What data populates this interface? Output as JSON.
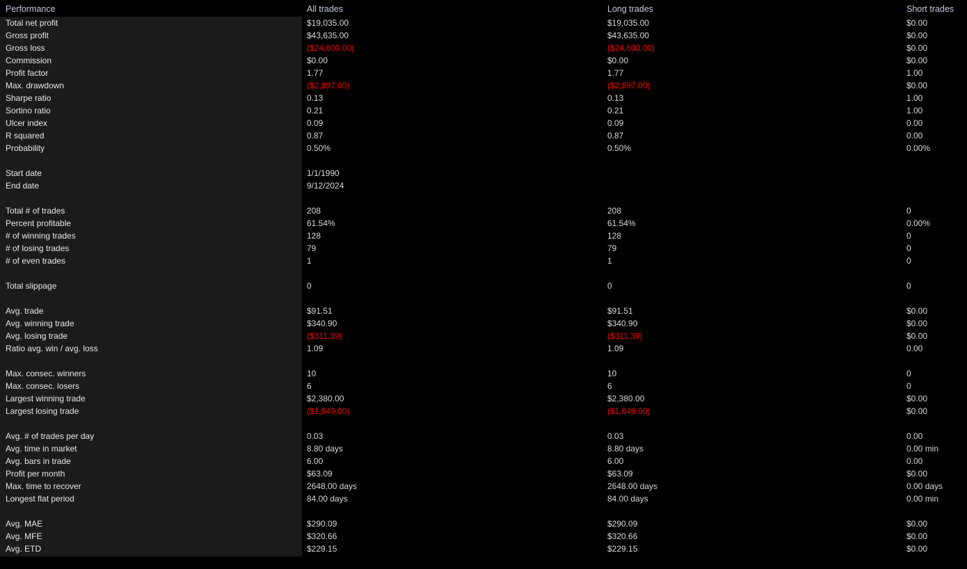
{
  "header": {
    "performance_label": "Performance",
    "all_trades_label": "All trades",
    "long_trades_label": "Long trades",
    "short_trades_label": "Short trades"
  },
  "colors": {
    "background": "#000000",
    "label_panel": "#1b1b1b",
    "header_text": "#c3ccda",
    "body_text": "#e8e8e8",
    "negative": "#ff0000"
  },
  "rows": [
    {
      "label": "Total net profit",
      "all": "$19,035.00",
      "long": "$19,035.00",
      "short": "$0.00",
      "all_neg": false,
      "long_neg": false,
      "short_neg": false
    },
    {
      "label": "Gross profit",
      "all": "$43,635.00",
      "long": "$43,635.00",
      "short": "$0.00",
      "all_neg": false,
      "long_neg": false,
      "short_neg": false
    },
    {
      "label": "Gross loss",
      "all": "($24,600.00)",
      "long": "($24,600.00)",
      "short": "$0.00",
      "all_neg": true,
      "long_neg": true,
      "short_neg": false
    },
    {
      "label": "Commission",
      "all": "$0.00",
      "long": "$0.00",
      "short": "$0.00",
      "all_neg": false,
      "long_neg": false,
      "short_neg": false
    },
    {
      "label": "Profit factor",
      "all": "1.77",
      "long": "1.77",
      "short": "1.00",
      "all_neg": false,
      "long_neg": false,
      "short_neg": false
    },
    {
      "label": "Max. drawdown",
      "all": "($2,897.00)",
      "long": "($2,897.00)",
      "short": "$0.00",
      "all_neg": true,
      "long_neg": true,
      "short_neg": false
    },
    {
      "label": "Sharpe ratio",
      "all": "0.13",
      "long": "0.13",
      "short": "1.00",
      "all_neg": false,
      "long_neg": false,
      "short_neg": false
    },
    {
      "label": "Sortino ratio",
      "all": "0.21",
      "long": "0.21",
      "short": "1.00",
      "all_neg": false,
      "long_neg": false,
      "short_neg": false
    },
    {
      "label": "Ulcer index",
      "all": "0.09",
      "long": "0.09",
      "short": "0.00",
      "all_neg": false,
      "long_neg": false,
      "short_neg": false
    },
    {
      "label": "R squared",
      "all": "0.87",
      "long": "0.87",
      "short": "0.00",
      "all_neg": false,
      "long_neg": false,
      "short_neg": false
    },
    {
      "label": "Probability",
      "all": "0.50%",
      "long": "0.50%",
      "short": "0.00%",
      "all_neg": false,
      "long_neg": false,
      "short_neg": false
    },
    {
      "spacer": true
    },
    {
      "label": "Start date",
      "all": "1/1/1990",
      "long": "",
      "short": "",
      "all_neg": false,
      "long_neg": false,
      "short_neg": false
    },
    {
      "label": "End date",
      "all": "9/12/2024",
      "long": "",
      "short": "",
      "all_neg": false,
      "long_neg": false,
      "short_neg": false
    },
    {
      "spacer": true
    },
    {
      "label": "Total # of trades",
      "all": "208",
      "long": "208",
      "short": "0",
      "all_neg": false,
      "long_neg": false,
      "short_neg": false
    },
    {
      "label": "Percent profitable",
      "all": "61.54%",
      "long": "61.54%",
      "short": "0.00%",
      "all_neg": false,
      "long_neg": false,
      "short_neg": false
    },
    {
      "label": "# of winning trades",
      "all": "128",
      "long": "128",
      "short": "0",
      "all_neg": false,
      "long_neg": false,
      "short_neg": false
    },
    {
      "label": "# of losing trades",
      "all": "79",
      "long": "79",
      "short": "0",
      "all_neg": false,
      "long_neg": false,
      "short_neg": false
    },
    {
      "label": "# of even trades",
      "all": "1",
      "long": "1",
      "short": "0",
      "all_neg": false,
      "long_neg": false,
      "short_neg": false
    },
    {
      "spacer": true
    },
    {
      "label": "Total slippage",
      "all": "0",
      "long": "0",
      "short": "0",
      "all_neg": false,
      "long_neg": false,
      "short_neg": false
    },
    {
      "spacer": true
    },
    {
      "label": "Avg. trade",
      "all": "$91.51",
      "long": "$91.51",
      "short": "$0.00",
      "all_neg": false,
      "long_neg": false,
      "short_neg": false
    },
    {
      "label": "Avg. winning trade",
      "all": "$340.90",
      "long": "$340.90",
      "short": "$0.00",
      "all_neg": false,
      "long_neg": false,
      "short_neg": false
    },
    {
      "label": "Avg. losing trade",
      "all": "($311.39)",
      "long": "($311.39)",
      "short": "$0.00",
      "all_neg": true,
      "long_neg": true,
      "short_neg": false
    },
    {
      "label": "Ratio avg. win / avg. loss",
      "all": "1.09",
      "long": "1.09",
      "short": "0.00",
      "all_neg": false,
      "long_neg": false,
      "short_neg": false
    },
    {
      "spacer": true
    },
    {
      "label": "Max. consec. winners",
      "all": "10",
      "long": "10",
      "short": "0",
      "all_neg": false,
      "long_neg": false,
      "short_neg": false
    },
    {
      "label": "Max. consec. losers",
      "all": "6",
      "long": "6",
      "short": "0",
      "all_neg": false,
      "long_neg": false,
      "short_neg": false
    },
    {
      "label": "Largest winning trade",
      "all": "$2,380.00",
      "long": "$2,380.00",
      "short": "$0.00",
      "all_neg": false,
      "long_neg": false,
      "short_neg": false
    },
    {
      "label": "Largest losing trade",
      "all": "($1,649.00)",
      "long": "($1,649.00)",
      "short": "$0.00",
      "all_neg": true,
      "long_neg": true,
      "short_neg": false
    },
    {
      "spacer": true
    },
    {
      "label": "Avg. # of trades per day",
      "all": "0.03",
      "long": "0.03",
      "short": "0.00",
      "all_neg": false,
      "long_neg": false,
      "short_neg": false
    },
    {
      "label": "Avg. time in market",
      "all": "8.80 days",
      "long": "8.80 days",
      "short": "0.00 min",
      "all_neg": false,
      "long_neg": false,
      "short_neg": false
    },
    {
      "label": "Avg. bars in trade",
      "all": "6.00",
      "long": "6.00",
      "short": "0.00",
      "all_neg": false,
      "long_neg": false,
      "short_neg": false
    },
    {
      "label": "Profit per month",
      "all": "$63.09",
      "long": "$63.09",
      "short": "$0.00",
      "all_neg": false,
      "long_neg": false,
      "short_neg": false
    },
    {
      "label": "Max. time to recover",
      "all": "2648.00 days",
      "long": "2648.00 days",
      "short": "0.00 days",
      "all_neg": false,
      "long_neg": false,
      "short_neg": false
    },
    {
      "label": "Longest flat period",
      "all": "84.00 days",
      "long": "84.00 days",
      "short": "0.00 min",
      "all_neg": false,
      "long_neg": false,
      "short_neg": false
    },
    {
      "spacer": true
    },
    {
      "label": "Avg. MAE",
      "all": "$290.09",
      "long": "$290.09",
      "short": "$0.00",
      "all_neg": false,
      "long_neg": false,
      "short_neg": false
    },
    {
      "label": "Avg. MFE",
      "all": "$320.66",
      "long": "$320.66",
      "short": "$0.00",
      "all_neg": false,
      "long_neg": false,
      "short_neg": false
    },
    {
      "label": "Avg. ETD",
      "all": "$229.15",
      "long": "$229.15",
      "short": "$0.00",
      "all_neg": false,
      "long_neg": false,
      "short_neg": false
    }
  ]
}
